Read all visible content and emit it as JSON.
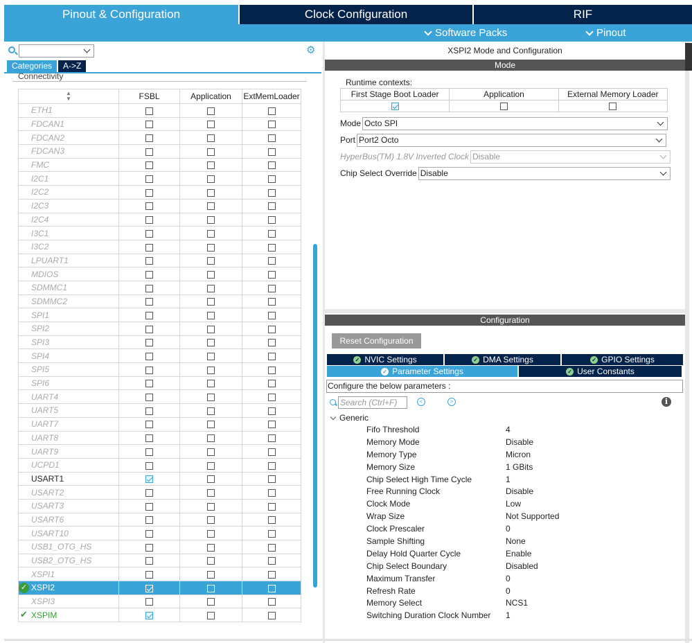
{
  "top_tabs": [
    {
      "label": "Pinout & Configuration",
      "active": true
    },
    {
      "label": "Clock Configuration",
      "active": false
    },
    {
      "label": "RIF",
      "active": false
    }
  ],
  "sub_menu": {
    "software_packs": "Software Packs",
    "pinout": "Pinout"
  },
  "left": {
    "search_value": "",
    "category_tabs": [
      "Categories",
      "A->Z"
    ],
    "group_label": "Connectivity",
    "columns": [
      "",
      "FSBL",
      "Application",
      "ExtMemLoader"
    ],
    "rows": [
      {
        "name": "ETH1",
        "state": "dim",
        "fsbl": false
      },
      {
        "name": "FDCAN1",
        "state": "dim",
        "fsbl": false
      },
      {
        "name": "FDCAN2",
        "state": "dim",
        "fsbl": false
      },
      {
        "name": "FDCAN3",
        "state": "dim",
        "fsbl": false
      },
      {
        "name": "FMC",
        "state": "dim",
        "fsbl": false
      },
      {
        "name": "I2C1",
        "state": "dim",
        "fsbl": false
      },
      {
        "name": "I2C2",
        "state": "dim",
        "fsbl": false
      },
      {
        "name": "I2C3",
        "state": "dim",
        "fsbl": false
      },
      {
        "name": "I2C4",
        "state": "dim",
        "fsbl": false
      },
      {
        "name": "I3C1",
        "state": "dim",
        "fsbl": false
      },
      {
        "name": "I3C2",
        "state": "dim",
        "fsbl": false
      },
      {
        "name": "LPUART1",
        "state": "dim",
        "fsbl": false
      },
      {
        "name": "MDIOS",
        "state": "dim",
        "fsbl": false
      },
      {
        "name": "SDMMC1",
        "state": "dim",
        "fsbl": false
      },
      {
        "name": "SDMMC2",
        "state": "dim",
        "fsbl": false
      },
      {
        "name": "SPI1",
        "state": "dim",
        "fsbl": false
      },
      {
        "name": "SPI2",
        "state": "dim",
        "fsbl": false
      },
      {
        "name": "SPI3",
        "state": "dim",
        "fsbl": false
      },
      {
        "name": "SPI4",
        "state": "dim",
        "fsbl": false
      },
      {
        "name": "SPI5",
        "state": "dim",
        "fsbl": false
      },
      {
        "name": "SPI6",
        "state": "dim",
        "fsbl": false
      },
      {
        "name": "UART4",
        "state": "dim",
        "fsbl": false
      },
      {
        "name": "UART5",
        "state": "dim",
        "fsbl": false
      },
      {
        "name": "UART7",
        "state": "dim",
        "fsbl": false
      },
      {
        "name": "UART8",
        "state": "dim",
        "fsbl": false
      },
      {
        "name": "UART9",
        "state": "dim",
        "fsbl": false
      },
      {
        "name": "UCPD1",
        "state": "dim",
        "fsbl": false
      },
      {
        "name": "USART1",
        "state": "on",
        "fsbl": true
      },
      {
        "name": "USART2",
        "state": "dim",
        "fsbl": false
      },
      {
        "name": "USART3",
        "state": "dim",
        "fsbl": false
      },
      {
        "name": "USART6",
        "state": "dim",
        "fsbl": false
      },
      {
        "name": "USART10",
        "state": "dim",
        "fsbl": false
      },
      {
        "name": "USB1_OTG_HS",
        "state": "dim",
        "fsbl": false
      },
      {
        "name": "USB2_OTG_HS",
        "state": "dim",
        "fsbl": false
      },
      {
        "name": "XSPI1",
        "state": "dim",
        "fsbl": false
      },
      {
        "name": "XSPI2",
        "state": "selected",
        "fsbl": true
      },
      {
        "name": "XSPI3",
        "state": "dim",
        "fsbl": false
      },
      {
        "name": "XSPIM",
        "state": "green",
        "fsbl": true
      }
    ]
  },
  "mode": {
    "title": "XSPI2 Mode and Configuration",
    "header": "Mode",
    "runtime_label": "Runtime contexts:",
    "contexts": [
      {
        "label": "First Stage Boot Loader",
        "checked": true
      },
      {
        "label": "Application",
        "checked": false
      },
      {
        "label": "External Memory Loader",
        "checked": false
      }
    ],
    "fields": [
      {
        "label": "Mode",
        "value": "Octo SPI",
        "dim": false
      },
      {
        "label": "Port",
        "value": "Port2 Octo",
        "dim": false
      },
      {
        "label": "HyperBus(TM) 1.8V Inverted Clock",
        "value": "Disable",
        "dim": true
      },
      {
        "label": "Chip Select Override",
        "value": "Disable",
        "dim": false
      }
    ]
  },
  "config": {
    "header": "Configuration",
    "reset_label": "Reset Configuration",
    "tabs_row1": [
      "NVIC Settings",
      "DMA Settings",
      "GPIO Settings"
    ],
    "tabs_row2": [
      "Parameter Settings",
      "User Constants"
    ],
    "description": "Configure the below parameters :",
    "search_placeholder": "Search (Ctrl+F)",
    "group": "Generic",
    "params": [
      {
        "name": "Fifo Threshold",
        "value": "4"
      },
      {
        "name": "Memory Mode",
        "value": "Disable"
      },
      {
        "name": "Memory Type",
        "value": "Micron"
      },
      {
        "name": "Memory Size",
        "value": "1 GBits"
      },
      {
        "name": "Chip Select High Time Cycle",
        "value": "1"
      },
      {
        "name": "Free Running Clock",
        "value": "Disable"
      },
      {
        "name": "Clock Mode",
        "value": "Low"
      },
      {
        "name": "Wrap Size",
        "value": "Not Supported"
      },
      {
        "name": "Clock Prescaler",
        "value": "0"
      },
      {
        "name": "Sample Shifting",
        "value": "None"
      },
      {
        "name": "Delay Hold Quarter Cycle",
        "value": "Enable"
      },
      {
        "name": "Chip Select Boundary",
        "value": "Disabled"
      },
      {
        "name": "Maximum Transfer",
        "value": "0"
      },
      {
        "name": "Refresh Rate",
        "value": "0"
      },
      {
        "name": "Memory Select",
        "value": "NCS1"
      },
      {
        "name": "Switching Duration Clock Number",
        "value": "1"
      }
    ]
  },
  "colors": {
    "accent": "#3aa4d8",
    "dark": "#03234b",
    "header_gray": "#555555",
    "green": "#3a9b3a"
  }
}
